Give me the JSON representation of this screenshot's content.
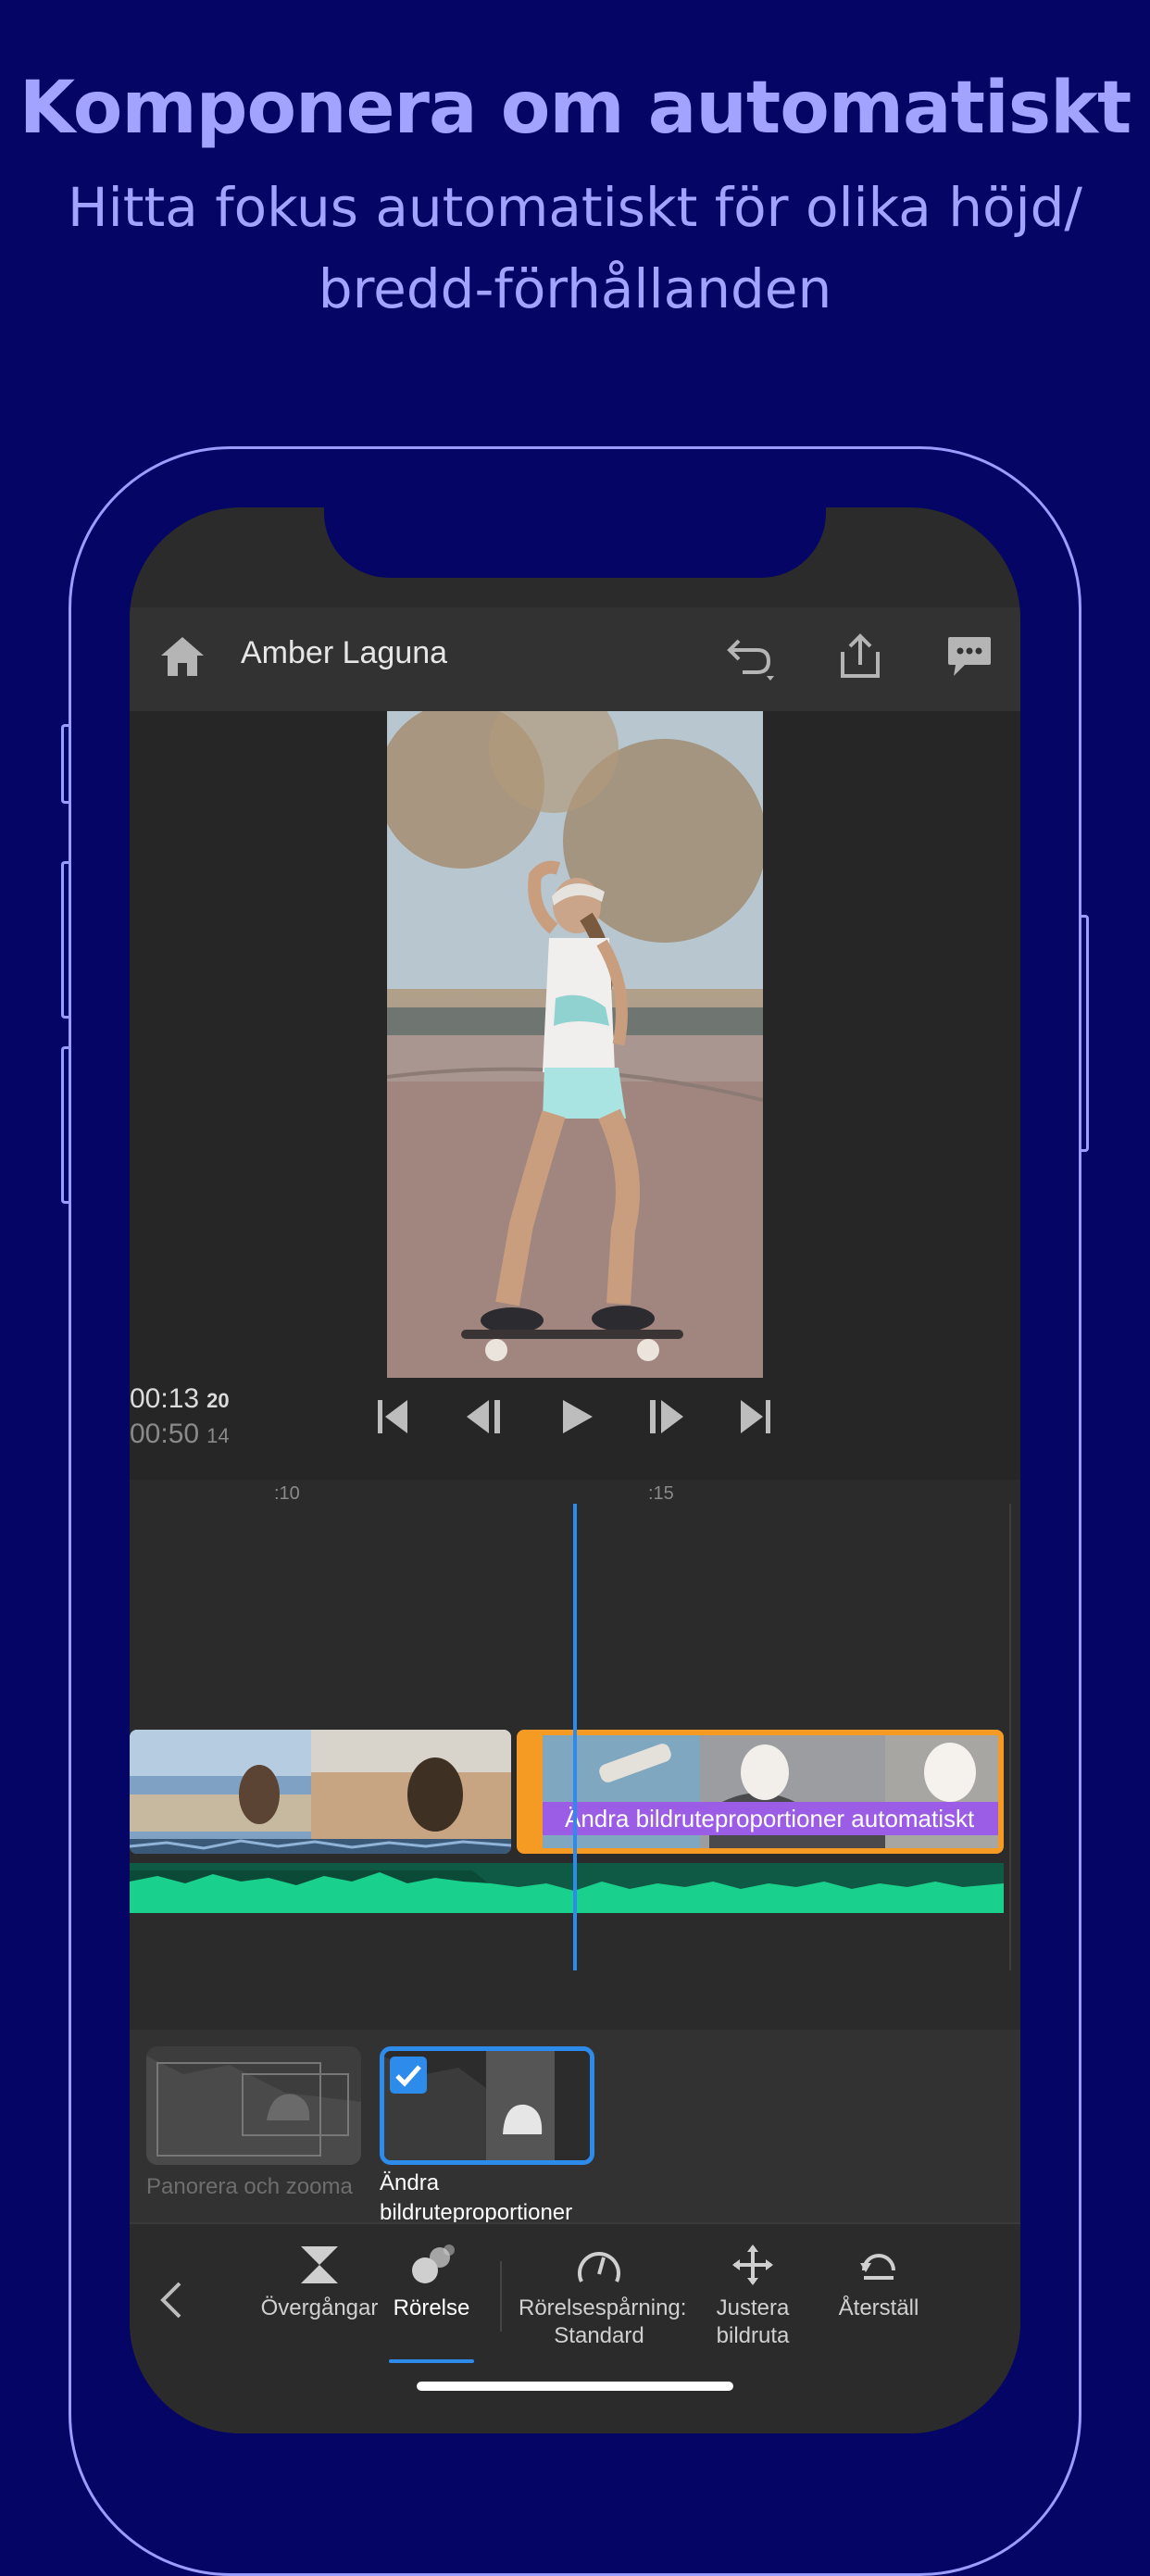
{
  "marketing": {
    "title": "Komponera om automatiskt",
    "subtitle": "Hitta fokus automatiskt för olika höjd/ bredd-förhållanden"
  },
  "app": {
    "project_title": "Amber Laguna",
    "icons": [
      "home-icon",
      "undo-icon",
      "share-icon",
      "comment-icon"
    ]
  },
  "player": {
    "current_time": "00:13",
    "current_frames": "20",
    "total_time": "00:50",
    "total_frames": "14",
    "controls": [
      "skip-to-start-icon",
      "step-back-icon",
      "play-icon",
      "step-forward-icon",
      "skip-to-end-icon"
    ]
  },
  "timeline": {
    "ruler_labels": [
      ":10",
      ":15"
    ],
    "clip2_banner": "Ändra bildruteproportioner automatiskt",
    "colors": {
      "playhead": "#2d8ceb",
      "selected_clip": "#f59a23",
      "banner": "#9b5de5",
      "audio": "#19d08c"
    }
  },
  "effects": {
    "pan_zoom_label": "Panorera och zooma",
    "reframe_label_line1": "Ändra",
    "reframe_label_line2": "bildruteproportioner"
  },
  "toolbar": {
    "transitions": "Övergångar",
    "motion": "Rörelse",
    "tracking_line1": "Rörelsespårning:",
    "tracking_line2": "Standard",
    "adjust_line1": "Justera",
    "adjust_line2": "bildruta",
    "reset": "Återställ"
  }
}
